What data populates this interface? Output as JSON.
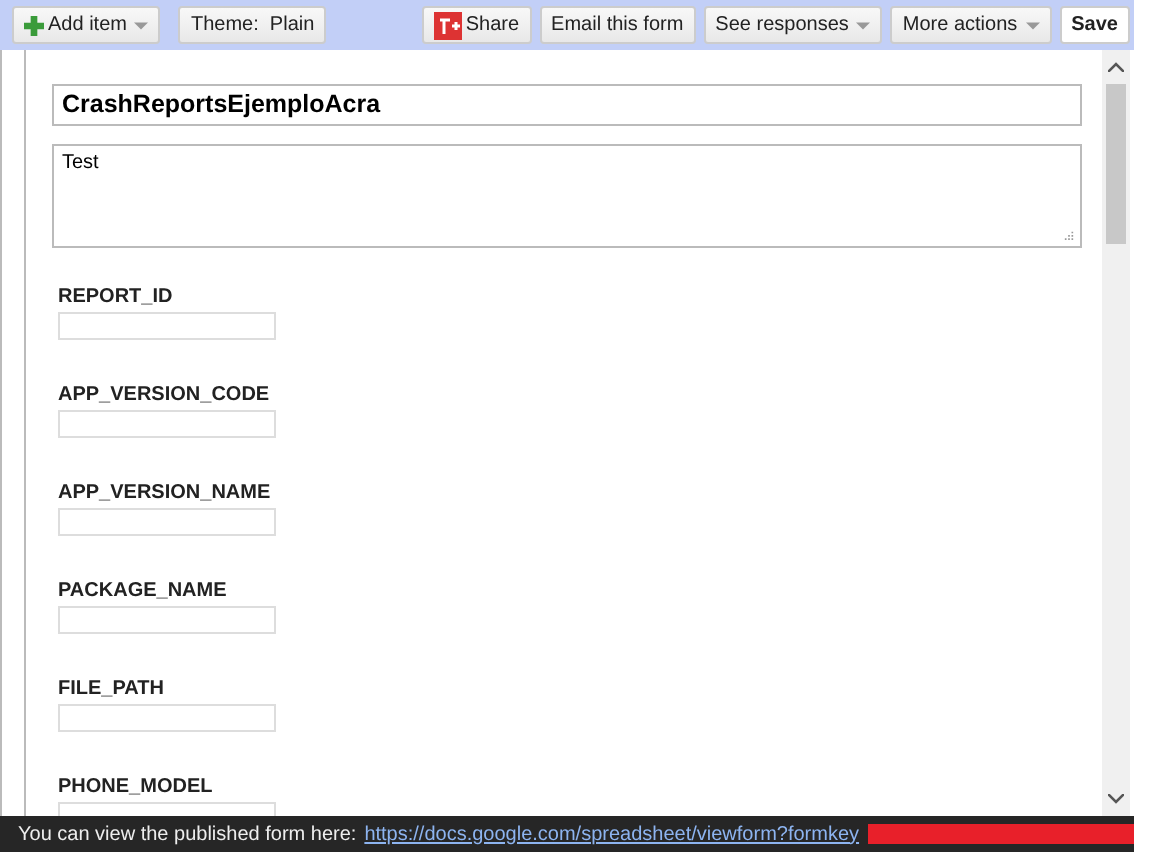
{
  "toolbar_left": [
    {
      "label": "Add item",
      "kind": "add",
      "dropdown": true
    },
    {
      "label": "Theme:  Plain",
      "kind": "plain",
      "dropdown": false
    }
  ],
  "toolbar_right": [
    {
      "label": "Share",
      "kind": "share",
      "dropdown": false
    },
    {
      "label": "Email this form",
      "kind": "plain",
      "dropdown": false
    },
    {
      "label": "See responses",
      "kind": "plain",
      "dropdown": true
    },
    {
      "label": "More actions",
      "kind": "plain",
      "dropdown": true
    },
    {
      "label": "Save",
      "kind": "save",
      "dropdown": false
    }
  ],
  "form": {
    "title": "CrashReportsEjemploAcra",
    "description": "Test",
    "questions": [
      {
        "label": "REPORT_ID"
      },
      {
        "label": "APP_VERSION_CODE"
      },
      {
        "label": "APP_VERSION_NAME"
      },
      {
        "label": "PACKAGE_NAME"
      },
      {
        "label": "FILE_PATH"
      },
      {
        "label": "PHONE_MODEL"
      }
    ]
  },
  "status_bar": {
    "text": "You can view the published form here:",
    "link": "https://docs.google.com/spreadsheet/viewform?formkey"
  }
}
